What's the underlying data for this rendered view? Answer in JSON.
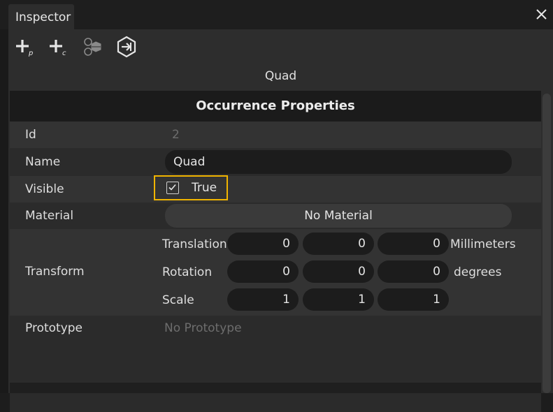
{
  "window": {
    "tab_title": "Inspector",
    "close_icon": "close-icon"
  },
  "toolbar": {
    "buttons": [
      {
        "name": "add-prototype-icon"
      },
      {
        "name": "add-component-icon"
      },
      {
        "name": "assembly-icon"
      },
      {
        "name": "import-icon"
      }
    ]
  },
  "object_title": "Quad",
  "section": {
    "title": "Occurrence Properties"
  },
  "properties": {
    "id_label": "Id",
    "id_value": "2",
    "name_label": "Name",
    "name_value": "Quad",
    "visible_label": "Visible",
    "visible_value": "True",
    "visible_checked": true,
    "material_label": "Material",
    "material_value": "No Material",
    "transform_label": "Transform",
    "translation_label": "Translation",
    "translation": [
      "0",
      "0",
      "0"
    ],
    "translation_unit": "Millimeters",
    "rotation_label": "Rotation",
    "rotation": [
      "0",
      "0",
      "0"
    ],
    "rotation_unit": "degrees",
    "scale_label": "Scale",
    "scale": [
      "1",
      "1",
      "1"
    ],
    "prototype_label": "Prototype",
    "prototype_value": "No Prototype"
  },
  "colors": {
    "highlight": "#f0b400",
    "panel": "#2d2d2d",
    "field": "#1c1c1c"
  }
}
